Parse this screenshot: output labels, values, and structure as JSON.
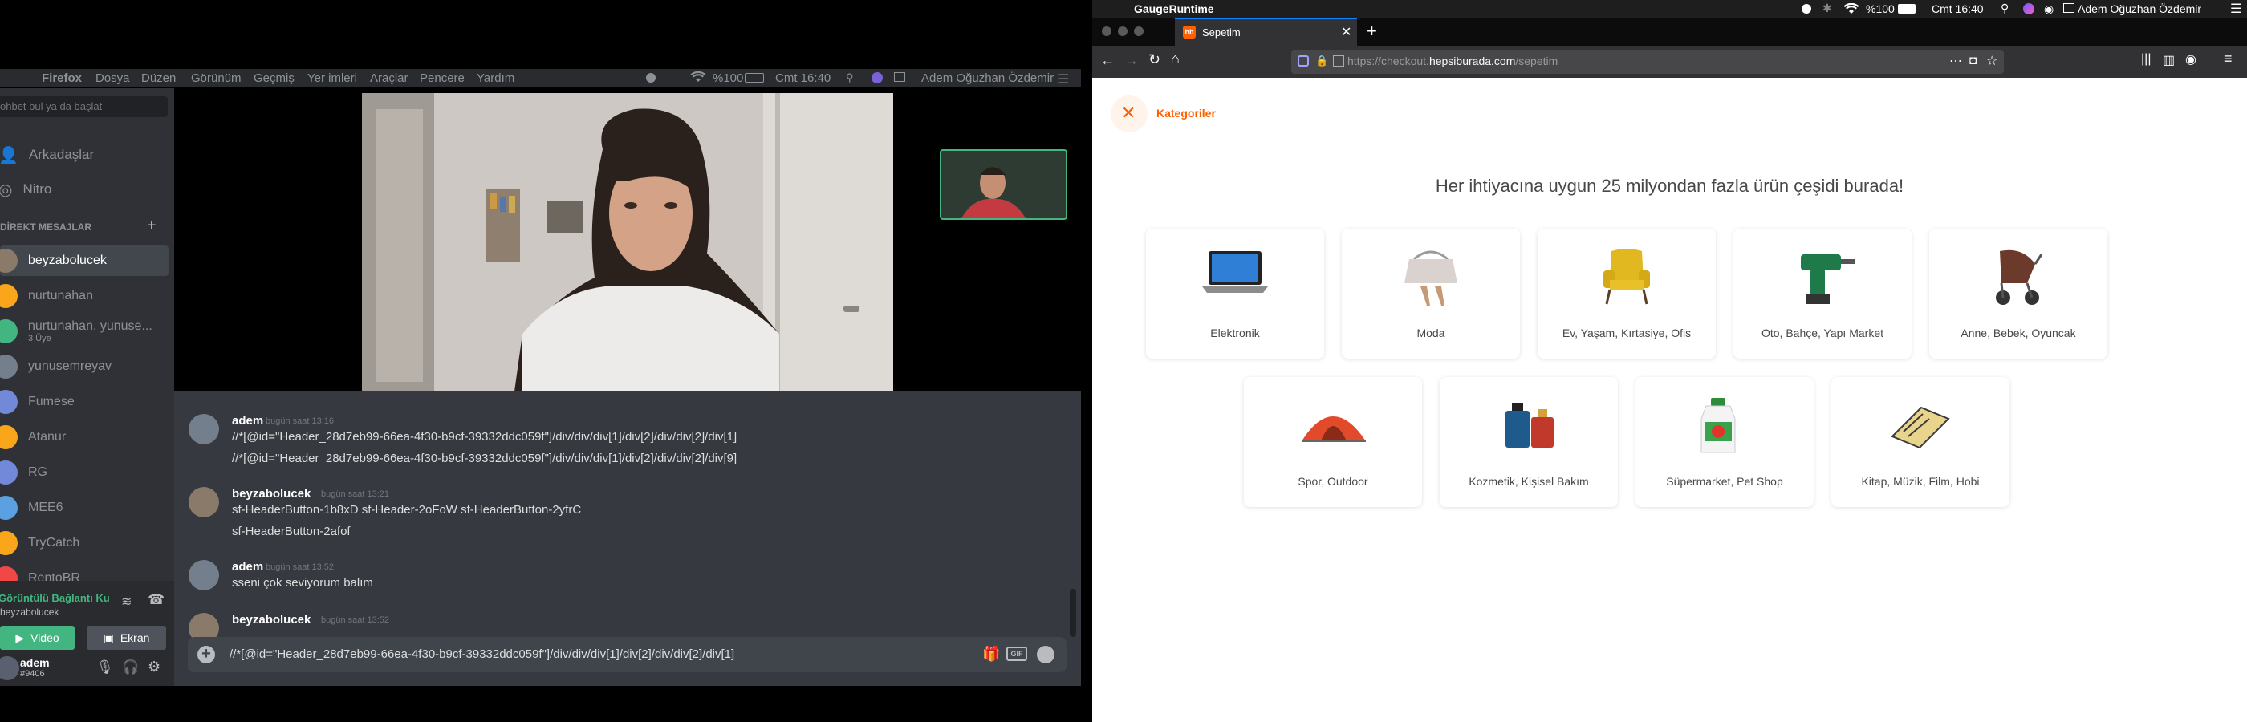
{
  "left_app": {
    "menubar": {
      "app": "Firefox",
      "items": [
        "Dosya",
        "Düzen",
        "Görünüm",
        "Geçmiş",
        "Yer imleri",
        "Araçlar",
        "Pencere",
        "Yardım"
      ],
      "battery": "%100",
      "clock": "Cmt 16:40",
      "user": "Adem Oğuzhan Özdemir"
    },
    "sidebar": {
      "search_placeholder": "ohbet bul ya da başlat",
      "friends": "Arkadaşlar",
      "nitro": "Nitro",
      "dm_header": "DİREKT MESAJLAR",
      "dms": [
        {
          "name": "beyzabolucek",
          "sub": "",
          "color": "#8a7a6a"
        },
        {
          "name": "nurtunahan",
          "sub": "",
          "color": "#faa61a"
        },
        {
          "name": "nurtunahan, yunuse...",
          "sub": "3 Üye",
          "color": "#43b581"
        },
        {
          "name": "yunusemreyav",
          "sub": "",
          "color": "#747f8d"
        },
        {
          "name": "Fumese",
          "sub": "",
          "color": "#7289da"
        },
        {
          "name": "Atanur",
          "sub": "",
          "color": "#faa61a"
        },
        {
          "name": "RG",
          "sub": "",
          "color": "#7289da"
        },
        {
          "name": "MEE6",
          "sub": "",
          "color": "#5ba0e0"
        },
        {
          "name": "TryCatch",
          "sub": "",
          "color": "#faa61a"
        },
        {
          "name": "RentoBR",
          "sub": "",
          "color": "#f04747"
        }
      ],
      "voice_status": "Görüntülü Bağlantı Ku",
      "voice_user": "beyzabolucek",
      "video_btn": "Video",
      "screen_btn": "Ekran",
      "user_name": "adem",
      "user_tag": "#9406"
    },
    "messages": [
      {
        "user": "adem",
        "time": "bugün saat 13:16",
        "lines": [
          "//*[@id=\"Header_28d7eb99-66ea-4f30-b9cf-39332ddc059f\"]/div/div/div[1]/div[2]/div/div[2]/div[1]",
          "//*[@id=\"Header_28d7eb99-66ea-4f30-b9cf-39332ddc059f\"]/div/div/div[1]/div[2]/div/div[2]/div[9]"
        ]
      },
      {
        "user": "beyzabolucek",
        "time": "bugün saat 13:21",
        "lines": [
          "sf-HeaderButton-1b8xD sf-Header-2oFoW sf-HeaderButton-2yfrC",
          "sf-HeaderButton-2afof"
        ]
      },
      {
        "user": "adem",
        "time": "bugün saat 13:52",
        "lines": [
          "sseni çok seviyorum balım"
        ]
      },
      {
        "user": "beyzabolucek",
        "time": "bugün saat 13:52",
        "lines": []
      }
    ],
    "composer_value": "//*[@id=\"Header_28d7eb99-66ea-4f30-b9cf-39332ddc059f\"]/div/div/div[1]/div[2]/div/div[2]/div[1]"
  },
  "right_app": {
    "menubar": {
      "app": "GaugeRuntime",
      "battery": "%100",
      "clock": "Cmt 16:40",
      "user": "Adem Oğuzhan Özdemir"
    },
    "tab": {
      "icon_text": "hb",
      "title": "Sepetim"
    },
    "url": {
      "prefix": "https://checkout.",
      "domain": "hepsiburada.com",
      "suffix": "/sepetim"
    },
    "page": {
      "categories_btn": "Kategoriler",
      "headline": "Her ihtiyacına uygun 25 milyondan fazla ürün çeşidi burada!",
      "categories": [
        {
          "label": "Elektronik",
          "icon": "laptop-icon"
        },
        {
          "label": "Moda",
          "icon": "handbag-icon"
        },
        {
          "label": "Ev, Yaşam, Kırtasiye, Ofis",
          "icon": "armchair-icon"
        },
        {
          "label": "Oto, Bahçe, Yapı Market",
          "icon": "drill-icon"
        },
        {
          "label": "Anne, Bebek, Oyuncak",
          "icon": "stroller-icon"
        },
        {
          "label": "Spor, Outdoor",
          "icon": "tent-icon"
        },
        {
          "label": "Kozmetik, Kişisel Bakım",
          "icon": "perfume-icon"
        },
        {
          "label": "Süpermarket, Pet Shop",
          "icon": "detergent-icon"
        },
        {
          "label": "Kitap, Müzik, Film, Hobi",
          "icon": "book-icon"
        }
      ]
    },
    "colors": {
      "brand": "#ff6000"
    }
  }
}
